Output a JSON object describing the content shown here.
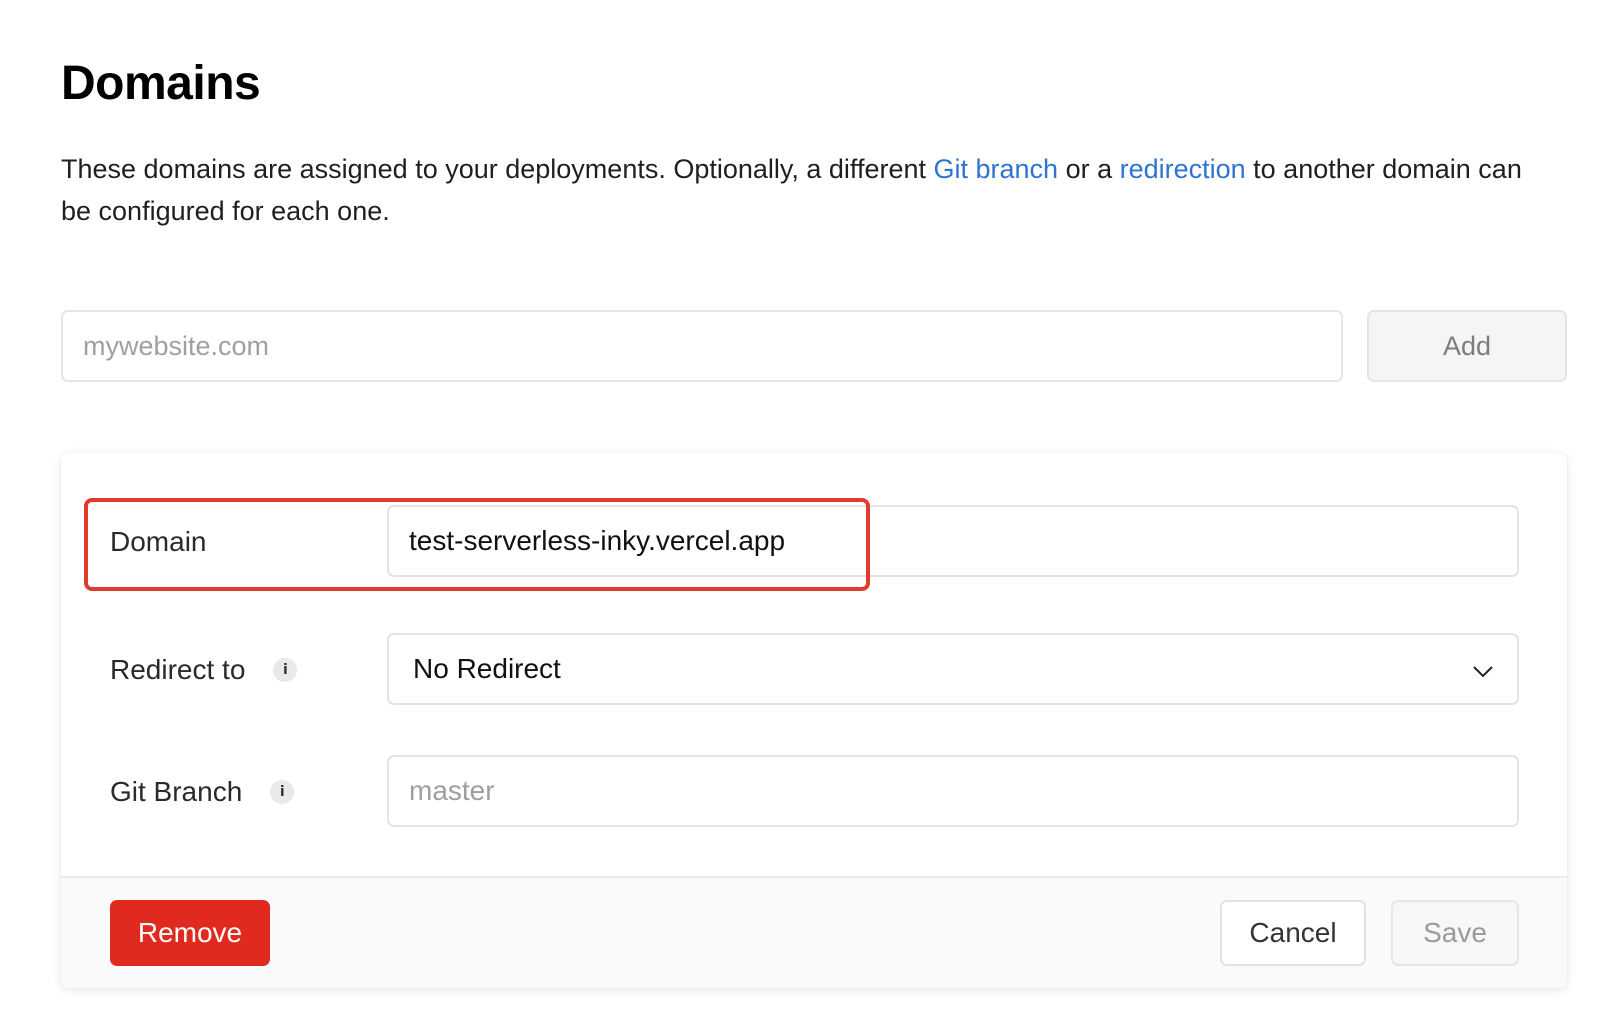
{
  "header": {
    "title": "Domains"
  },
  "description": {
    "part1": "These domains are assigned to your deployments. Optionally, a different ",
    "link_git_branch": "Git branch",
    "part2": " or a ",
    "link_redirection": "redirection",
    "part3": " to another domain can be configured for each one."
  },
  "add_domain": {
    "placeholder": "mywebsite.com",
    "value": "",
    "button_label": "Add"
  },
  "domain_card": {
    "domain": {
      "label": "Domain",
      "value": "test-serverless-inky.vercel.app"
    },
    "redirect": {
      "label": "Redirect to",
      "info_icon": "i",
      "selected": "No Redirect"
    },
    "git_branch": {
      "label": "Git Branch",
      "info_icon": "i",
      "placeholder": "master",
      "value": ""
    },
    "footer": {
      "remove_label": "Remove",
      "cancel_label": "Cancel",
      "save_label": "Save"
    }
  },
  "colors": {
    "link": "#2f74d0",
    "danger": "#e02a1f",
    "highlight": "#e03c2e"
  }
}
